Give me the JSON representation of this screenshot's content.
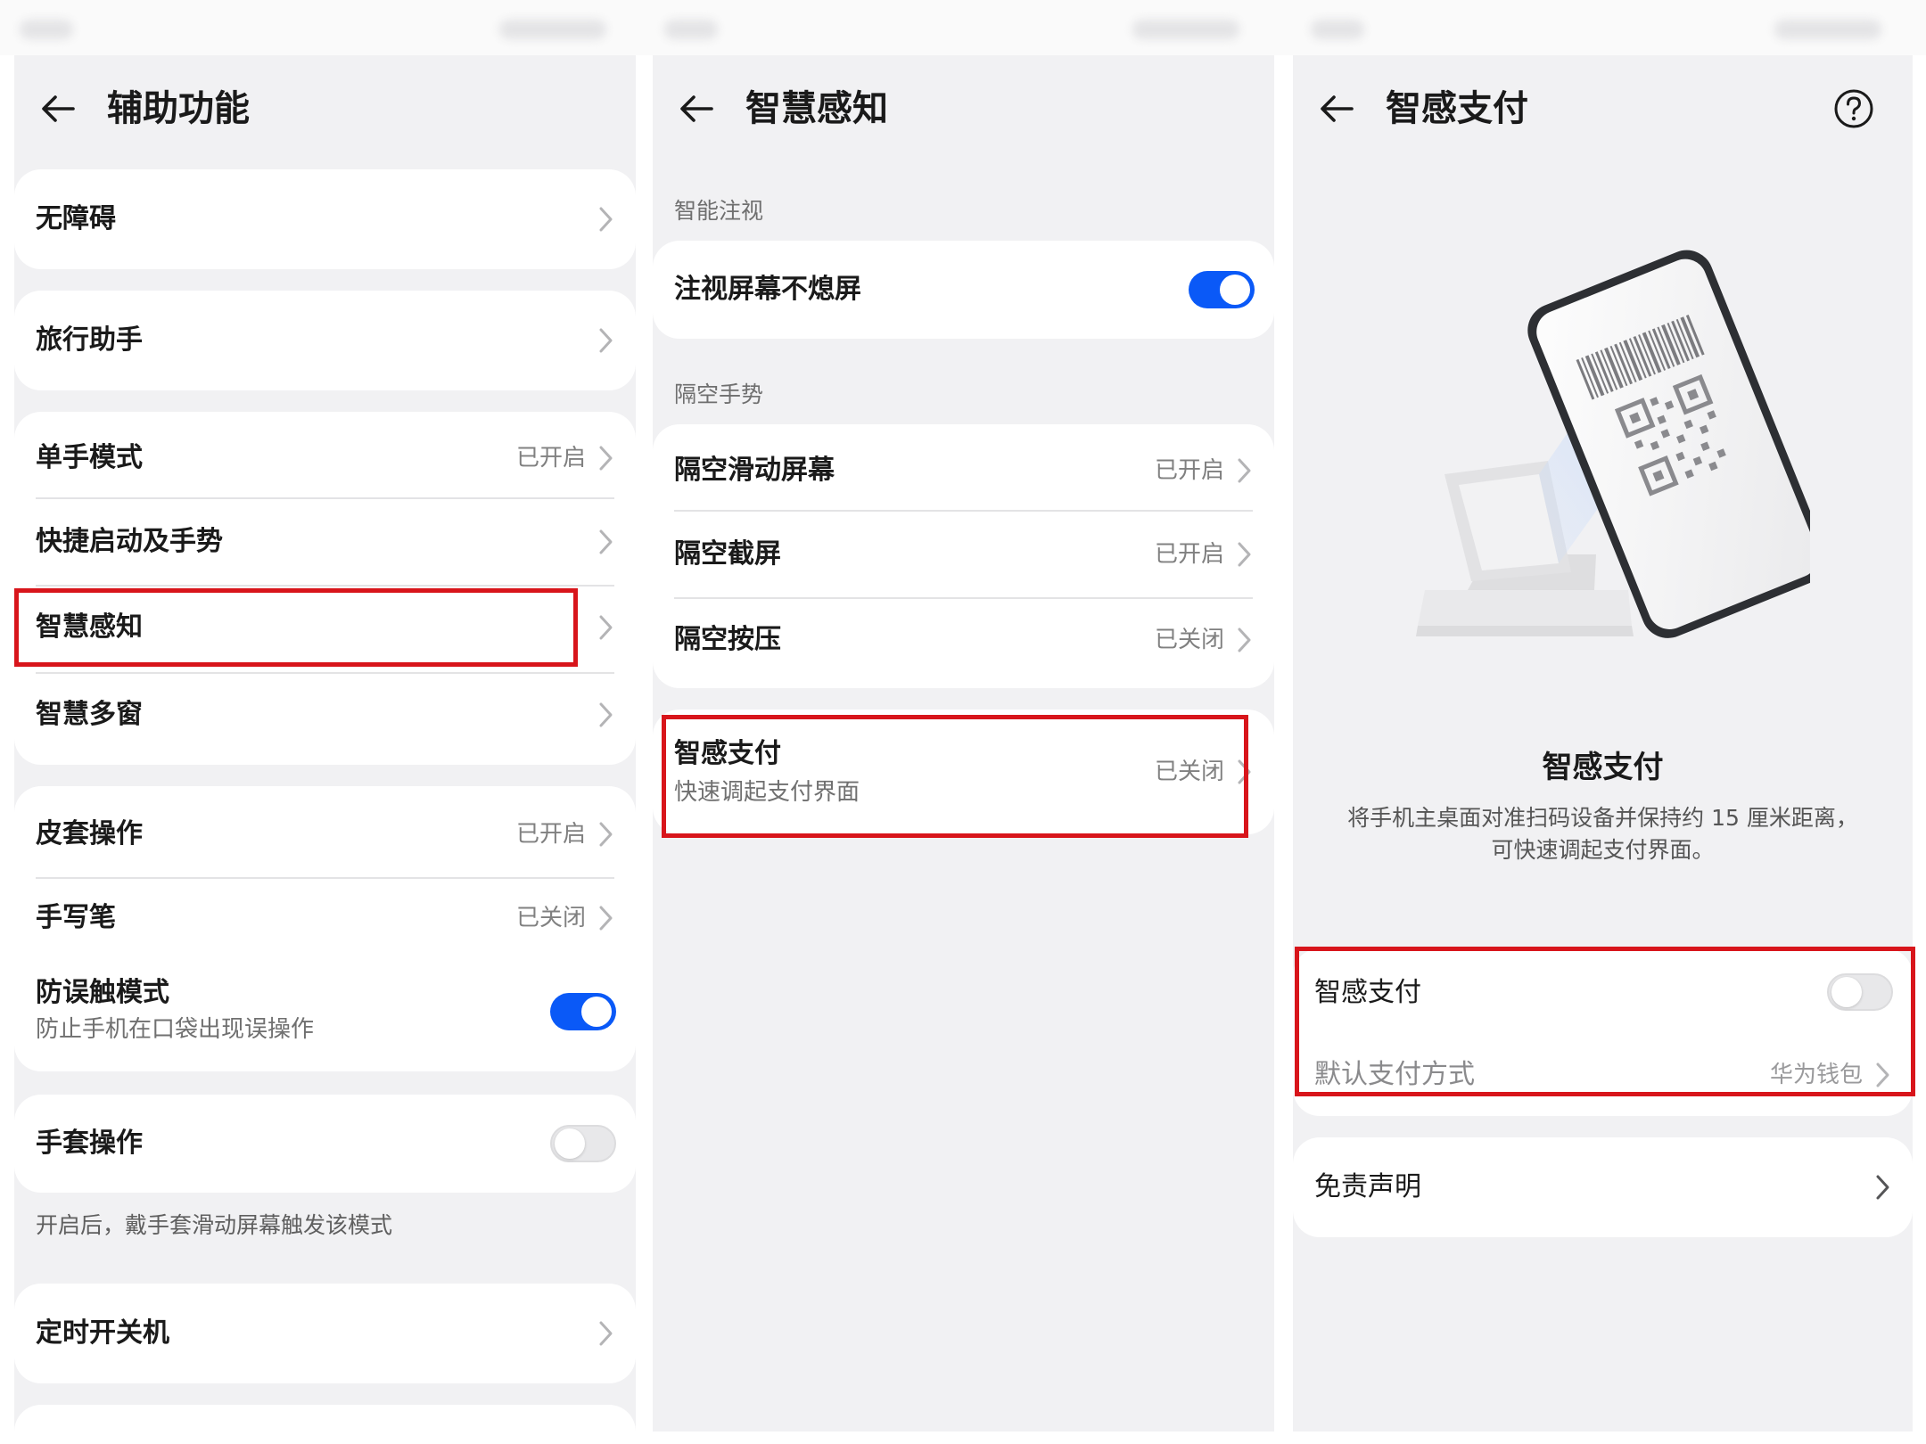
{
  "panel1": {
    "title": "辅助功能",
    "items": {
      "accessibility": {
        "label": "无障碍"
      },
      "travel": {
        "label": "旅行助手"
      },
      "one_hand": {
        "label": "单手模式",
        "value": "已开启"
      },
      "shortcuts": {
        "label": "快捷启动及手势"
      },
      "smart_sense": {
        "label": "智慧感知"
      },
      "multi_window": {
        "label": "智慧多窗"
      },
      "cover": {
        "label": "皮套操作",
        "value": "已开启"
      },
      "stylus": {
        "label": "手写笔",
        "value": "已关闭"
      },
      "accidental_touch": {
        "label": "防误触模式",
        "sub": "防止手机在口袋出现误操作",
        "toggle": true
      },
      "glove": {
        "label": "手套操作",
        "toggle": false,
        "caption": "开启后，戴手套滑动屏幕触发该模式"
      },
      "schedule_power": {
        "label": "定时开关机"
      }
    }
  },
  "panel2": {
    "title": "智慧感知",
    "sections": {
      "gaze": {
        "heading": "智能注视",
        "items": {
          "gaze_screen": {
            "label": "注视屏幕不熄屏",
            "toggle": true
          }
        }
      },
      "air_gesture": {
        "heading": "隔空手势",
        "items": {
          "air_swipe": {
            "label": "隔空滑动屏幕",
            "value": "已开启"
          },
          "air_screenshot": {
            "label": "隔空截屏",
            "value": "已开启"
          },
          "air_press": {
            "label": "隔空按压",
            "value": "已关闭"
          }
        }
      },
      "smart_pay": {
        "label": "智感支付",
        "sub": "快速调起支付界面",
        "value": "已关闭"
      }
    }
  },
  "panel3": {
    "title": "智感支付",
    "intro_title": "智感支付",
    "intro_desc_1": "将手机主桌面对准扫码设备并保持约 15 厘米距离，",
    "intro_desc_2": "可快速调起支付界面。",
    "smart_pay_toggle": {
      "label": "智感支付",
      "toggle": false
    },
    "default_pay": {
      "label": "默认支付方式",
      "value": "华为钱包"
    },
    "disclaimer": {
      "label": "免责声明"
    }
  },
  "colors": {
    "accent": "#0a59f7",
    "highlight": "#d8151b",
    "background": "#f1f1f3",
    "card": "#ffffff"
  },
  "icons": [
    "back-arrow-icon",
    "chevron-right-icon",
    "help-circle-icon",
    "scan-pay-illustration"
  ]
}
